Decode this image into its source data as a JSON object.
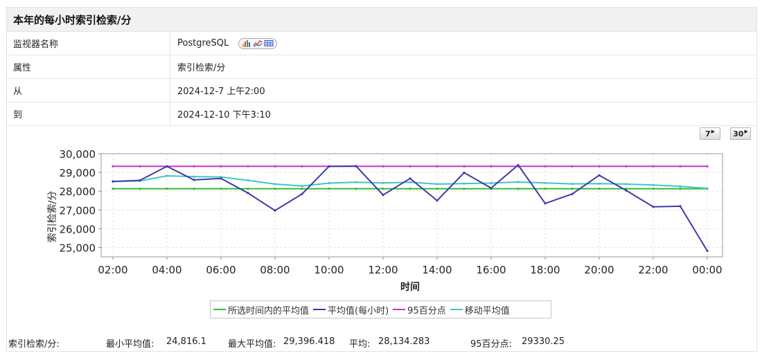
{
  "title": "本年的每小时索引检索/分",
  "info": {
    "monitor_label": "监视器名称",
    "monitor_value": "PostgreSQL",
    "attr_label": "属性",
    "attr_value": "索引检索/分",
    "from_label": "从",
    "from_value": "2024-12-7 上午2:00",
    "to_label": "到",
    "to_value": "2024-12-10 下午3:10"
  },
  "chart_type_icons": [
    "bar-chart-icon",
    "line-chart-icon",
    "table-icon"
  ],
  "period_buttons": [
    "7",
    "30"
  ],
  "chart_data": {
    "type": "line",
    "title": "",
    "xlabel": "时间",
    "ylabel": "索引检索/分",
    "ylim": [
      24500,
      30000
    ],
    "yticks": [
      25000,
      26000,
      27000,
      28000,
      29000,
      30000
    ],
    "ytick_labels": [
      "25,000",
      "26,000",
      "27,000",
      "28,000",
      "29,000",
      "30,000"
    ],
    "x": [
      2,
      3,
      4,
      5,
      6,
      7,
      8,
      9,
      10,
      11,
      12,
      13,
      14,
      15,
      16,
      17,
      18,
      19,
      20,
      21,
      22,
      23,
      24
    ],
    "xticks": [
      2,
      4,
      6,
      8,
      10,
      12,
      14,
      16,
      18,
      20,
      22,
      24
    ],
    "xtick_labels": [
      "02:00",
      "04:00",
      "06:00",
      "08:00",
      "10:00",
      "12:00",
      "14:00",
      "16:00",
      "18:00",
      "20:00",
      "22:00",
      "00:00"
    ],
    "xlim": [
      2,
      24
    ],
    "grid": true,
    "legend_position": "bottom-center",
    "series": [
      {
        "name": "所选时间内的平均值",
        "color": "#33bb33",
        "values": [
          28134,
          28134,
          28134,
          28134,
          28134,
          28134,
          28134,
          28134,
          28134,
          28134,
          28134,
          28134,
          28134,
          28134,
          28134,
          28134,
          28134,
          28134,
          28134,
          28134,
          28134,
          28134,
          28134
        ]
      },
      {
        "name": "平均值(每小时)",
        "color": "#3b3ba8",
        "values": [
          28520,
          28580,
          29330,
          28600,
          28680,
          27900,
          26970,
          27850,
          29330,
          29340,
          27800,
          28680,
          27500,
          28990,
          28170,
          29396,
          27350,
          27850,
          28850,
          28040,
          27170,
          27200,
          24816
        ]
      },
      {
        "name": "95百分点",
        "color": "#cc33cc",
        "values": [
          29330,
          29330,
          29330,
          29330,
          29330,
          29330,
          29330,
          29330,
          29330,
          29330,
          29330,
          29330,
          29330,
          29330,
          29330,
          29330,
          29330,
          29330,
          29330,
          29330,
          29330,
          29330,
          29330
        ]
      },
      {
        "name": "移动平均值",
        "color": "#44c4c4",
        "values": [
          28520,
          28550,
          28820,
          28780,
          28760,
          28580,
          28380,
          28280,
          28430,
          28480,
          28440,
          28480,
          28380,
          28410,
          28430,
          28490,
          28440,
          28390,
          28400,
          28380,
          28330,
          28260,
          28150
        ]
      }
    ]
  },
  "stats": {
    "label": "索引检索/分:",
    "min_label": "最小平均值:",
    "min_value": "24,816.1",
    "max_label": "最大平均值:",
    "max_value": "29,396.418",
    "avg_label": "平均:",
    "avg_value": "28,134.283",
    "p95_label": "95百分点:",
    "p95_value": "29330.25"
  }
}
